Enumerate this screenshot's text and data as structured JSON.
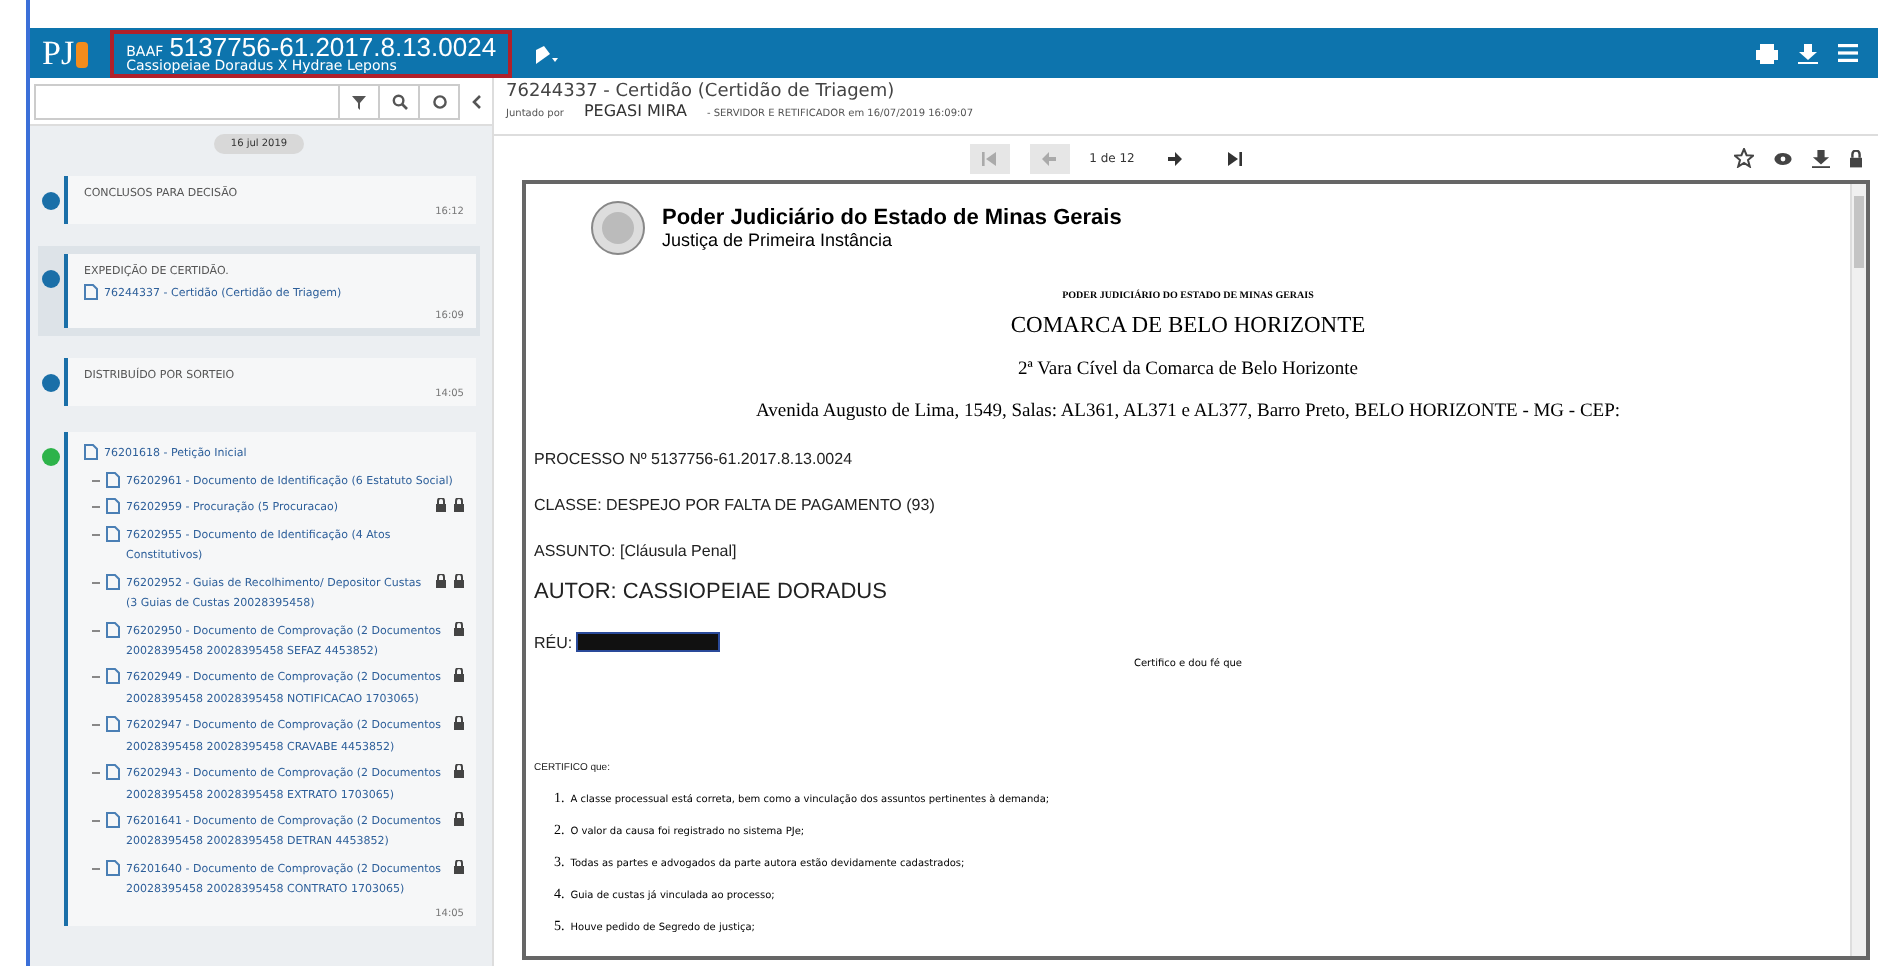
{
  "header": {
    "logo": "PJ",
    "case_class": "BAAF",
    "case_number": "5137756-61.2017.8.13.0024",
    "parties": "Cassiopeiae Doradus X Hydrae Lepons"
  },
  "timeline": {
    "date": "16 jul 2019",
    "events": [
      {
        "title": "CONCLUSOS PARA DECISÃO",
        "time": "16:12",
        "color": "#1a6fa8",
        "selected": false
      },
      {
        "title": "EXPEDIÇÃO DE CERTIDÃO.",
        "time": "16:09",
        "color": "#1a6fa8",
        "selected": true,
        "docs": [
          {
            "text": "76244337 - Certidão (Certidão de Triagem)",
            "locked": false,
            "restricted": false
          }
        ]
      },
      {
        "title": "DISTRIBUÍDO POR SORTEIO",
        "time": "14:05",
        "color": "#1a6fa8",
        "selected": false
      },
      {
        "time": "14:05",
        "color": "#2db34a",
        "selected": false,
        "main_doc": "76201618 - Petição Inicial",
        "docs": [
          {
            "text": "76202961 - Documento de Identificação (6 Estatuto Social)",
            "locked": false,
            "restricted": false
          },
          {
            "text": "76202959 - Procuração (5 Procuracao)",
            "locked": true,
            "restricted": true
          },
          {
            "text": "76202955 - Documento de Identificação (4 Atos Constitutivos)",
            "locked": false,
            "restricted": false
          },
          {
            "text": "76202952 - Guias de Recolhimento/ Depositor Custas (3 Guias de Custas 20028395458)",
            "locked": true,
            "restricted": true
          },
          {
            "text": "76202950 - Documento de Comprovação (2 Documentos 20028395458 20028395458 SEFAZ 4453852)",
            "locked": true,
            "restricted": false
          },
          {
            "text": "76202949 - Documento de Comprovação (2 Documentos 20028395458 20028395458 NOTIFICACAO 1703065)",
            "locked": true,
            "restricted": false
          },
          {
            "text": "76202947 - Documento de Comprovação (2 Documentos 20028395458 20028395458 CRAVABE 4453852)",
            "locked": true,
            "restricted": false
          },
          {
            "text": "76202943 - Documento de Comprovação (2 Documentos 20028395458 20028395458 EXTRATO 1703065)",
            "locked": true,
            "restricted": false
          },
          {
            "text": "76201641 - Documento de Comprovação (2 Documentos 20028395458 20028395458 DETRAN 4453852)",
            "locked": true,
            "restricted": false
          },
          {
            "text": "76201640 - Documento de Comprovação (2 Documentos 20028395458 20028395458 CONTRATO 1703065)",
            "locked": true,
            "restricted": false
          }
        ]
      }
    ]
  },
  "document": {
    "title": "76244337 - Certidão (Certidão de Triagem)",
    "added_by_label": "Juntado por",
    "added_by": "PEGASI MIRA",
    "role": "- SERVIDOR E RETIFICADOR em 16/07/2019 16:09:07",
    "page": "1 de 12"
  },
  "page": {
    "court": "Poder Judiciário do Estado de Minas Gerais",
    "instance": "Justiça de Primeira Instância",
    "heading_small": "PODER JUDICIÁRIO DO ESTADO DE MINAS GERAIS",
    "comarca": "COMARCA DE BELO HORIZONTE",
    "vara": "2ª Vara Cível da Comarca de Belo Horizonte",
    "address": "Avenida Augusto de Lima, 1549, Salas: AL361, AL371 e AL377, Barro Preto, BELO HORIZONTE - MG - CEP:",
    "processo": "PROCESSO Nº 5137756-61.2017.8.13.0024",
    "classe": "CLASSE: DESPEJO POR FALTA DE PAGAMENTO (93)",
    "assunto": "ASSUNTO: [Cláusula Penal]",
    "autor": "AUTOR: CASSIOPEIAE DORADUS",
    "reu": "RÉU:",
    "certifico_fe": "Certifico e dou fé que",
    "certifico": "CERTIFICO que:",
    "items": [
      {
        "num": "1.",
        "text": "A classe processual está correta, bem como a vinculação dos assuntos pertinentes à demanda;"
      },
      {
        "num": "2.",
        "text": "O valor da causa foi registrado no sistema PJe;"
      },
      {
        "num": "3.",
        "text": "Todas as partes e advogados da parte autora estão devidamente cadastrados;"
      },
      {
        "num": "4.",
        "text": "Guia de custas já vinculada ao processo;"
      },
      {
        "num": "5.",
        "text": "Houve pedido de Segredo de justiça;"
      }
    ]
  }
}
